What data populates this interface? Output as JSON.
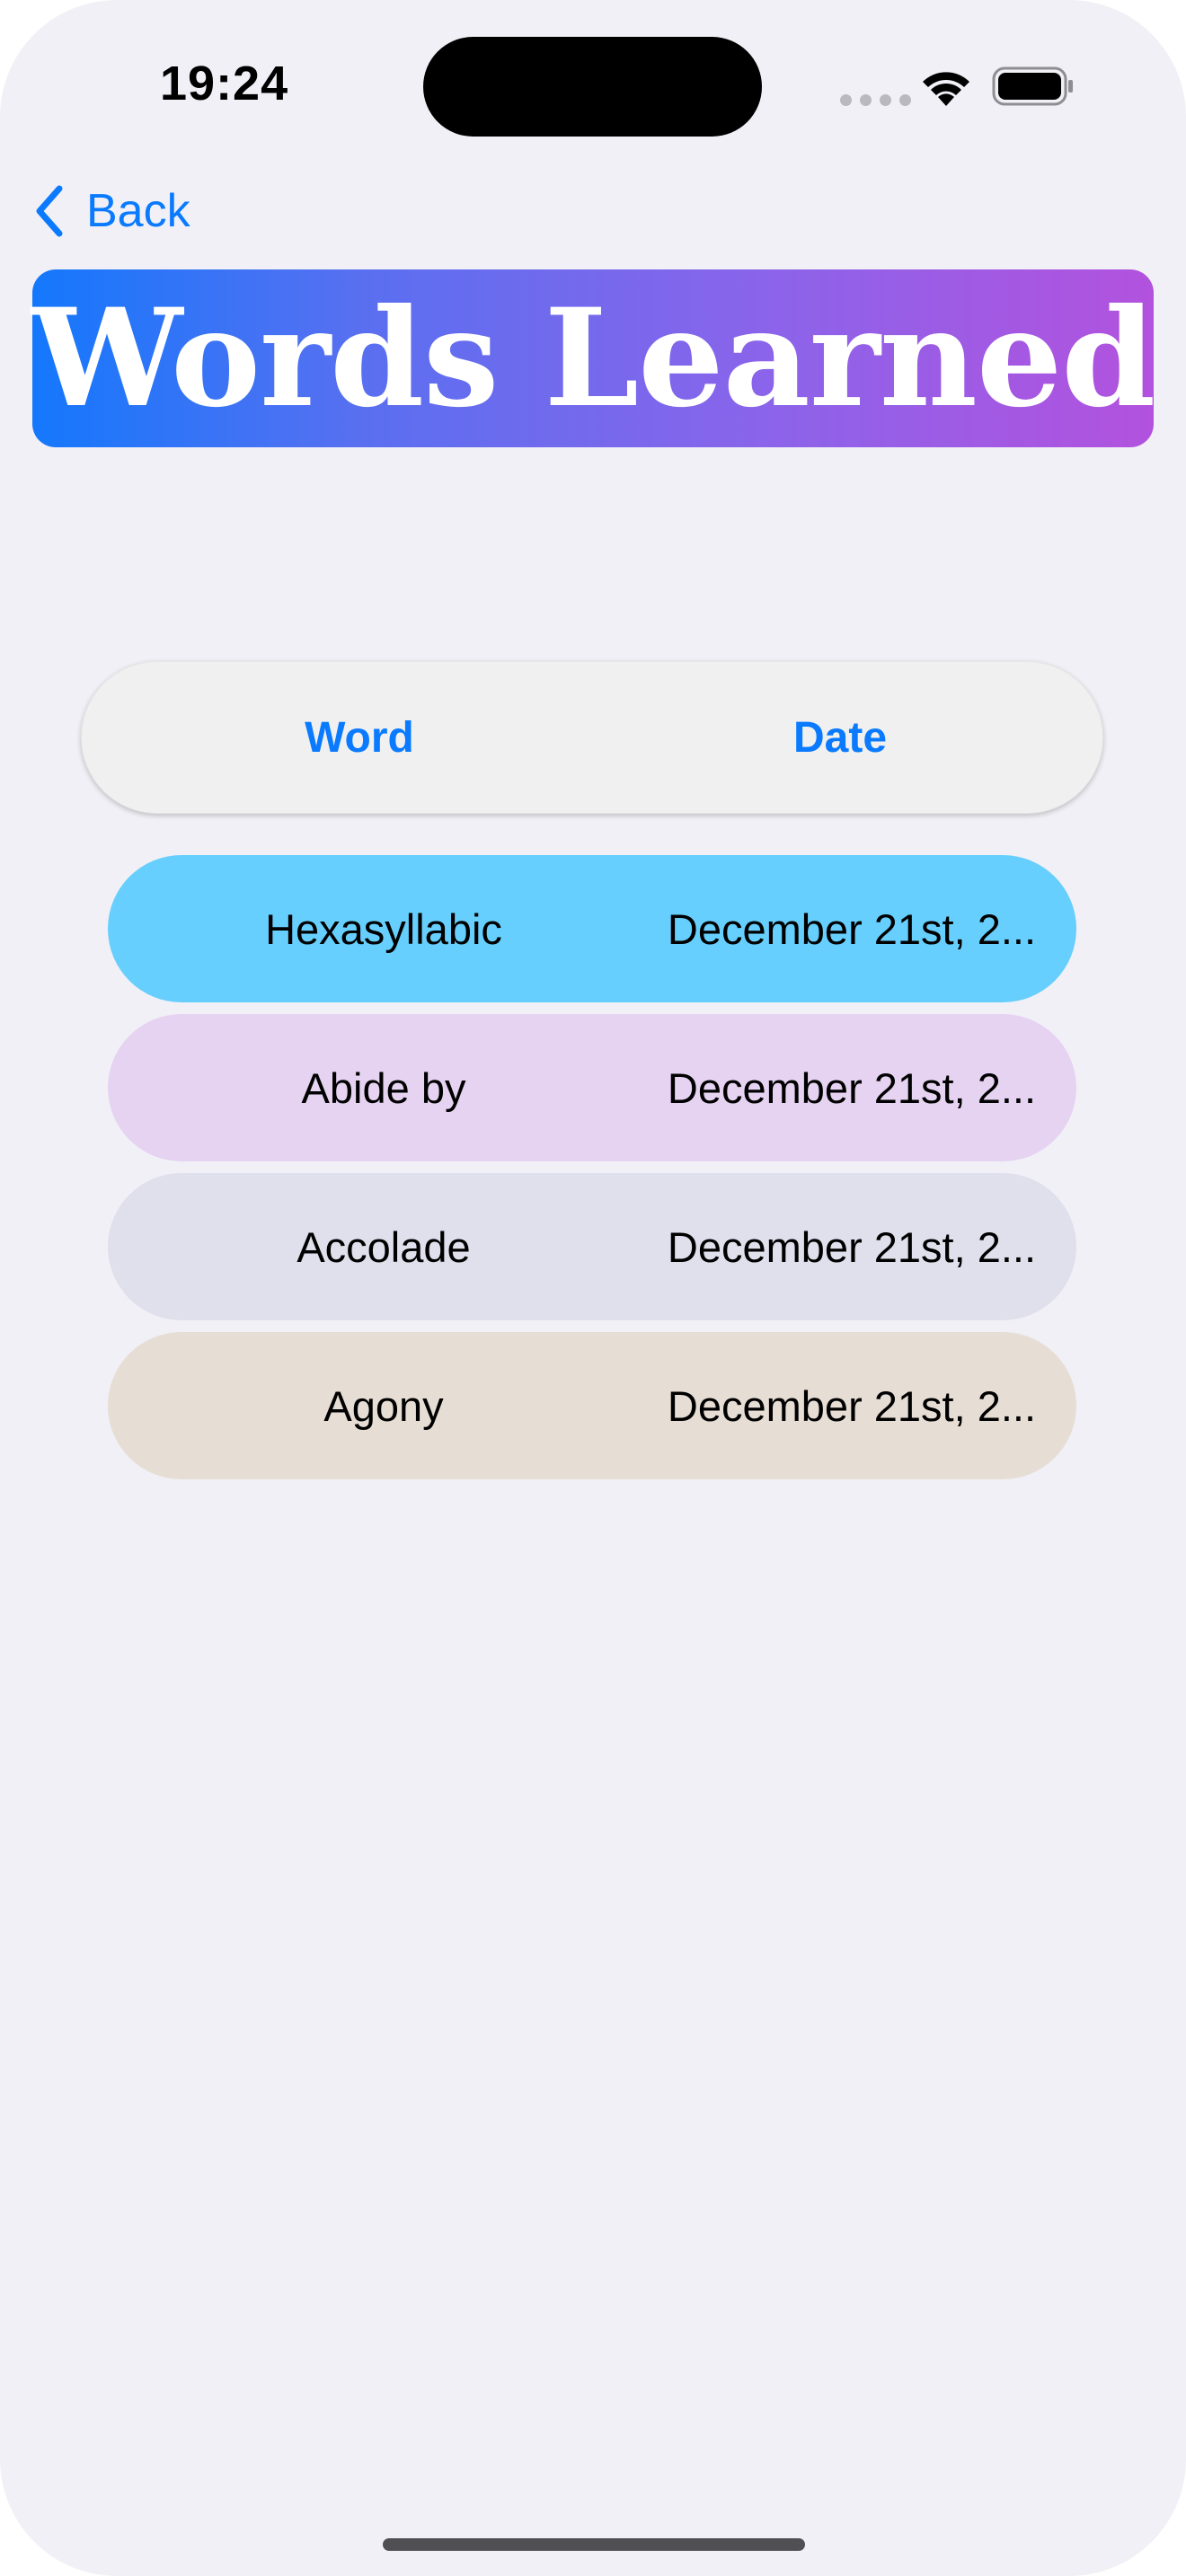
{
  "status_bar": {
    "time": "19:24"
  },
  "nav": {
    "back_label": "Back",
    "accent_color": "#0a7aff"
  },
  "title": "Words Learned",
  "table": {
    "headers": [
      "Word",
      "Date"
    ],
    "rows": [
      {
        "word": "Hexasyllabic",
        "date": "December 21st, 2...",
        "color": "#66cffd"
      },
      {
        "word": "Abide by",
        "date": "December 21st, 2...",
        "color": "#e6d3f2"
      },
      {
        "word": "Accolade",
        "date": "December 21st, 2...",
        "color": "#e0dfec"
      },
      {
        "word": "Agony",
        "date": "December 21st, 2...",
        "color": "#e6ddd4"
      }
    ]
  }
}
